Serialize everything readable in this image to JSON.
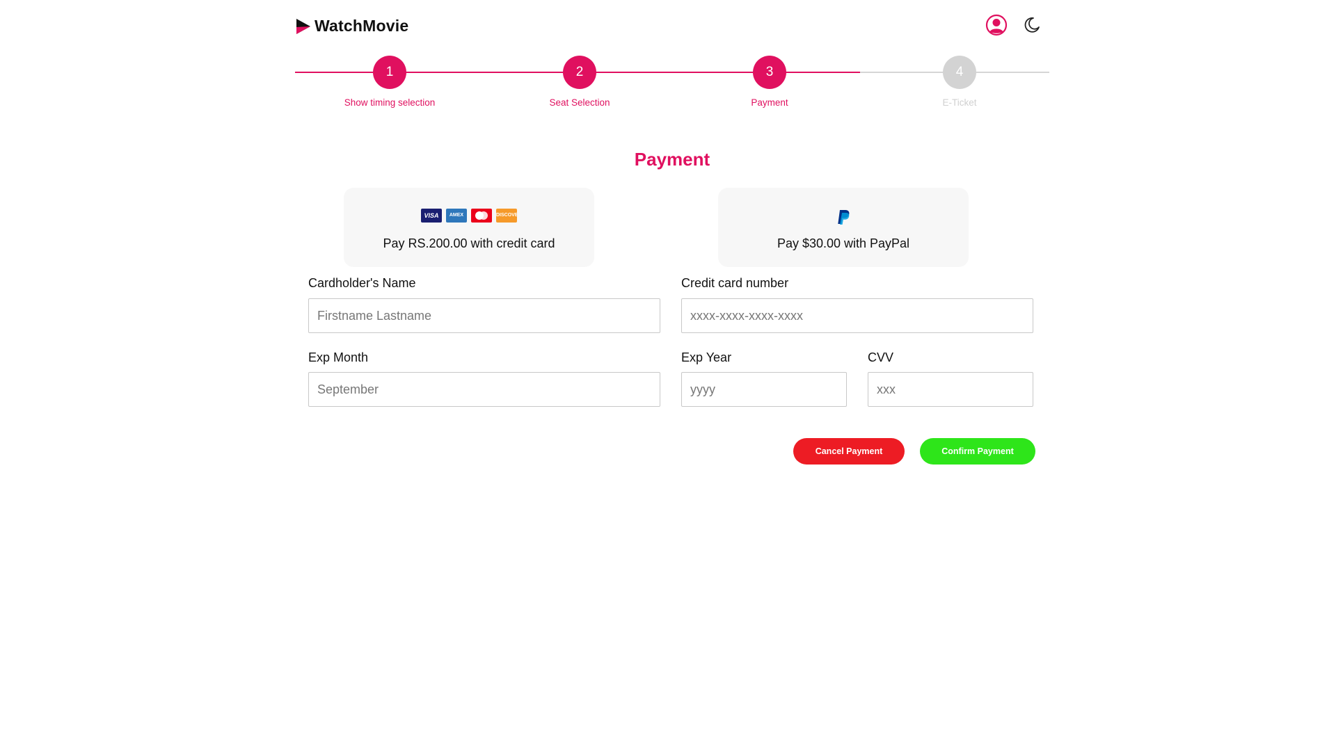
{
  "app": {
    "name": "WatchMovie"
  },
  "header": {
    "profile_icon": "user-circle-icon",
    "theme_icon": "moon-icon"
  },
  "stepper": {
    "steps": [
      {
        "number": "1",
        "label": "Show timing selection",
        "state": "active"
      },
      {
        "number": "2",
        "label": "Seat Selection",
        "state": "active"
      },
      {
        "number": "3",
        "label": "Payment",
        "state": "active"
      },
      {
        "number": "4",
        "label": "E-Ticket",
        "state": "inactive"
      }
    ]
  },
  "page_title": "Payment",
  "methods": {
    "credit_card": {
      "text": "Pay RS.200.00 with credit card",
      "logos": [
        "VISA",
        "AMEX",
        "MC",
        "DISCOVER"
      ]
    },
    "paypal": {
      "text": "Pay $30.00 with PayPal",
      "logo": "P"
    }
  },
  "form": {
    "cardholder_name": {
      "label": "Cardholder's Name",
      "placeholder": "Firstname Lastname",
      "value": ""
    },
    "card_number": {
      "label": "Credit card number",
      "placeholder": "xxxx-xxxx-xxxx-xxxx",
      "value": ""
    },
    "exp_month": {
      "label": "Exp Month",
      "placeholder": "September",
      "value": ""
    },
    "exp_year": {
      "label": "Exp Year",
      "placeholder": "yyyy",
      "value": ""
    },
    "cvv": {
      "label": "CVV",
      "placeholder": "xxx",
      "value": ""
    }
  },
  "actions": {
    "cancel_label": "Cancel Payment",
    "confirm_label": "Confirm Payment"
  },
  "colors": {
    "accent": "#e0105f",
    "inactive": "#d3d3d3",
    "cancel": "#ed1c24",
    "confirm": "#2ee51a"
  }
}
